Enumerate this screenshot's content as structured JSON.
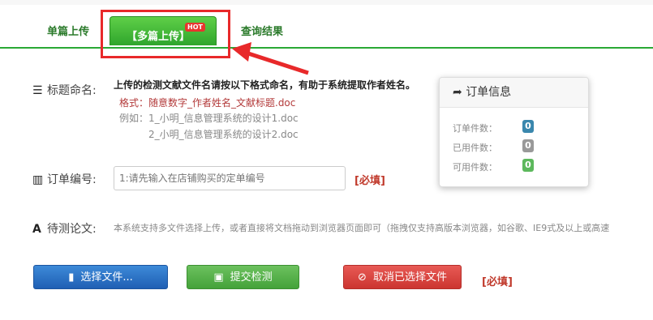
{
  "tabs": {
    "single": "单篇上传",
    "multi": "【多篇上传】",
    "multi_badge": "HOT",
    "query": "查询结果"
  },
  "title_section": {
    "label": "标题命名:",
    "instruction": "上传的检测文献文件名请按以下格式命名，有助于系统提取作者姓名。",
    "format": "格式：随意数字_作者姓名_文献标题.doc",
    "example1": "例如：1_小明_信息管理系统的设计1.doc",
    "example2": "2_小明_信息管理系统的设计2.doc"
  },
  "order_section": {
    "label": "订单编号:",
    "placeholder": "1:请先输入在店铺购买的定单编号",
    "required": "[必填]"
  },
  "paper_section": {
    "label": "待测论文:",
    "description": "本系统支持多文件选择上传，或者直接将文档拖动到浏览器页面即可（拖拽仅支持高版本浏览器，如谷歌、IE9式及以上或高速"
  },
  "buttons": {
    "choose": "选择文件...",
    "submit": "提交检测",
    "cancel": "取消已选择文件",
    "required": "[必填]"
  },
  "order_panel": {
    "title": "订单信息",
    "rows": [
      {
        "label": "订单件数：",
        "count": "0",
        "color": "#3a87ad"
      },
      {
        "label": "已用件数：",
        "count": "0",
        "color": "#999999"
      },
      {
        "label": "可用件数：",
        "count": "0",
        "color": "#5cb85c"
      }
    ]
  },
  "icons": {
    "list": "list-icon",
    "barcode": "barcode-icon",
    "font": "font-icon",
    "file": "file-icon",
    "inbox": "inbox-icon",
    "ban": "ban-icon",
    "share": "share-icon"
  }
}
